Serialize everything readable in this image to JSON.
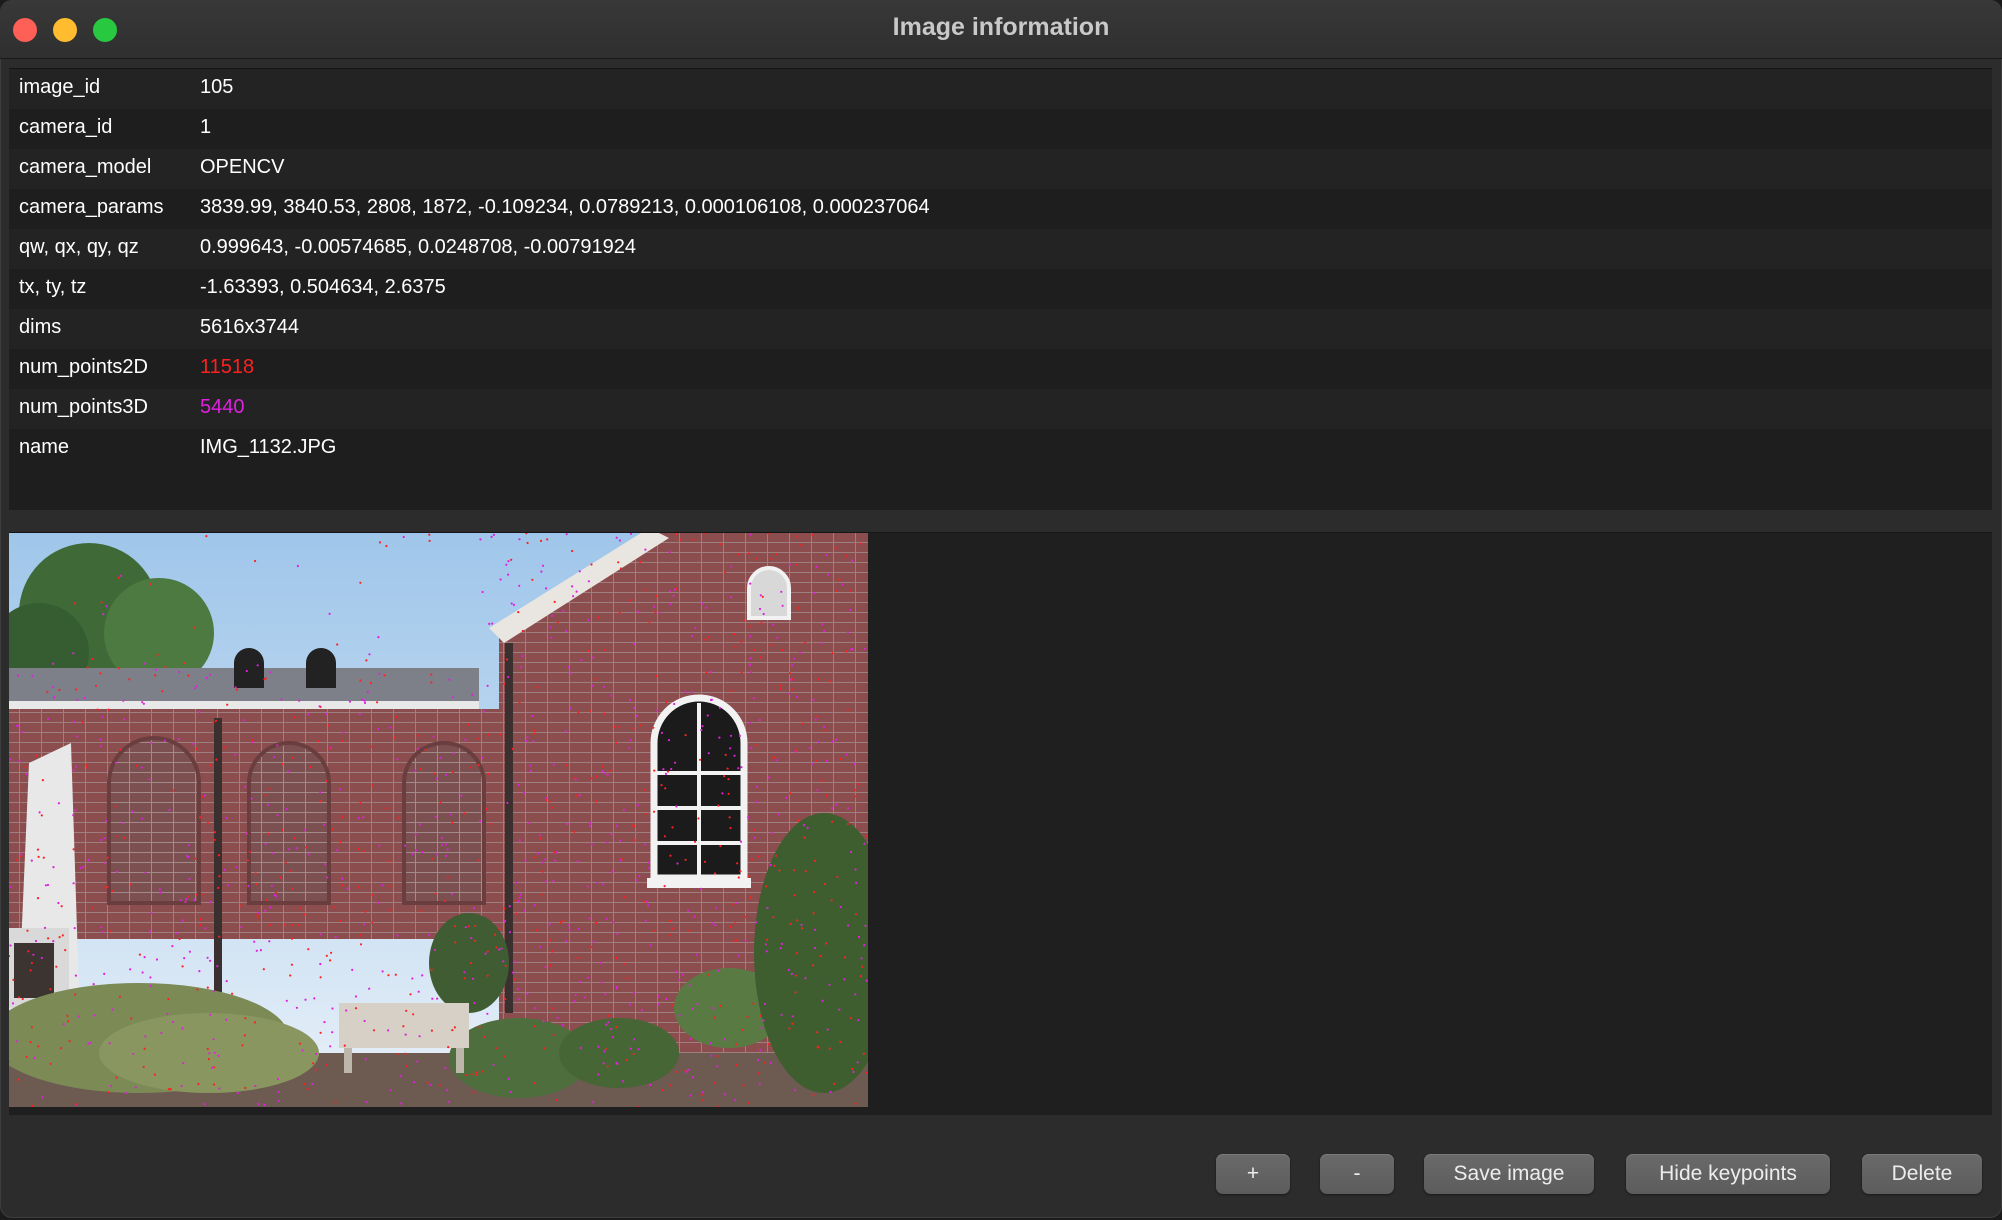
{
  "window": {
    "title": "Image information"
  },
  "info": [
    {
      "key": "image_id",
      "value": "105"
    },
    {
      "key": "camera_id",
      "value": "1"
    },
    {
      "key": "camera_model",
      "value": "OPENCV"
    },
    {
      "key": "camera_params",
      "value": "3839.99, 3840.53, 2808, 1872, -0.109234, 0.0789213, 0.000106108, 0.000237064"
    },
    {
      "key": "qw, qx, qy, qz",
      "value": "0.999643, -0.00574685, 0.0248708, -0.00791924"
    },
    {
      "key": "tx, ty, tz",
      "value": "-1.63393, 0.504634, 2.6375"
    },
    {
      "key": "dims",
      "value": "5616x3744"
    },
    {
      "key": "num_points2D",
      "value": "11518",
      "color": "#ff2020"
    },
    {
      "key": "num_points3D",
      "value": "5440",
      "color": "#e020e0"
    },
    {
      "key": "name",
      "value": "IMG_1132.JPG"
    }
  ],
  "buttons": {
    "zoom_in": "+",
    "zoom_out": "-",
    "save": "Save image",
    "hide_keypoints": "Hide keypoints",
    "delete": "Delete"
  },
  "colors": {
    "keypoint_2d": "#ff2020",
    "keypoint_3d": "#e020e0"
  }
}
